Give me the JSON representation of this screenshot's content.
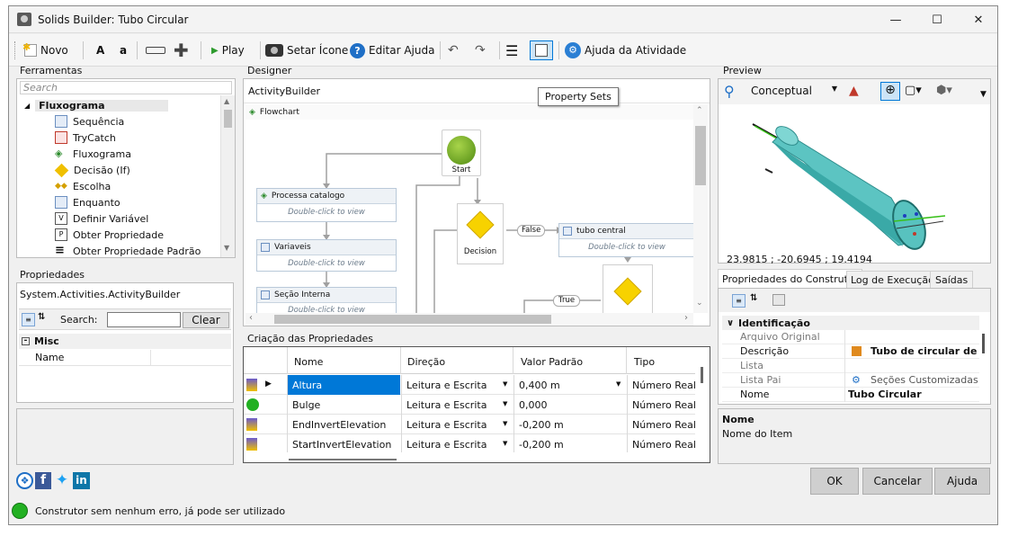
{
  "window": {
    "title": "Solids Builder: Tubo Circular"
  },
  "toolbar": {
    "novo": "Novo",
    "a_upper": "A",
    "a_lower": "a",
    "play": "Play",
    "setar_icone": "Setar Ícone",
    "editar_ajuda": "Editar Ajuda",
    "ajuda_atividade": "Ajuda da Atividade"
  },
  "tooltip": "Property Sets",
  "ferramentas": {
    "title": "Ferramentas",
    "search_placeholder": "Search",
    "group": "Fluxograma",
    "items": [
      "Sequência",
      "TryCatch",
      "Fluxograma",
      "Decisão (If)",
      "Escolha",
      "Enquanto",
      "Definir Variável",
      "Obter Propriedade",
      "Obter Propriedade Padrão"
    ]
  },
  "propriedades": {
    "title": "Propriedades",
    "object": "System.Activities.ActivityBuilder",
    "search_label": "Search:",
    "clear": "Clear",
    "category": "Misc",
    "row_name": "Name"
  },
  "designer": {
    "title": "Designer",
    "breadcrumb": "ActivityBuilder",
    "flowchart": "Flowchart",
    "start": "Start",
    "decision": "Decision",
    "false_label": "False",
    "true_label": "True",
    "dbl": "Double-click to view",
    "activities": [
      "Processa catalogo",
      "Variaveis",
      "Seção Interna",
      "tubo central"
    ]
  },
  "criacao": {
    "title": "Criação das Propriedades",
    "columns": [
      "Nome",
      "Direção",
      "Valor Padrão",
      "Tipo"
    ],
    "rows": [
      {
        "nome": "Altura",
        "direcao": "Leitura e Escrita",
        "valor": "0,400 m",
        "tipo": "Número Real"
      },
      {
        "nome": "Bulge",
        "direcao": "Leitura e Escrita",
        "valor": "0,000",
        "tipo": "Número Real"
      },
      {
        "nome": "EndInvertElevation",
        "direcao": "Leitura e Escrita",
        "valor": "-0,200 m",
        "tipo": "Número Real"
      },
      {
        "nome": "StartInvertElevation",
        "direcao": "Leitura e Escrita",
        "valor": "-0,200 m",
        "tipo": "Número Real"
      }
    ]
  },
  "preview": {
    "title": "Preview",
    "style": "Conceptual",
    "coords": "23.9815 ; -20.6945 ; 19.4194"
  },
  "tabs": [
    "Propriedades do Construtor",
    "Log de Execução",
    "Saídas"
  ],
  "construtor": {
    "category": "Identificação",
    "rows": [
      {
        "label": "Arquivo Original",
        "value": ""
      },
      {
        "label": "Descrição",
        "value": "Tubo de circular de"
      },
      {
        "label": "Lista",
        "value": ""
      },
      {
        "label": "Lista Pai",
        "value": "Seções Customizadas"
      },
      {
        "label": "Nome",
        "value": "Tubo Circular"
      }
    ],
    "help_title": "Nome",
    "help_text": "Nome do Item"
  },
  "buttons": {
    "ok": "OK",
    "cancelar": "Cancelar",
    "ajuda": "Ajuda"
  },
  "status": "Construtor sem nenhum erro, já pode ser utilizado",
  "colors": {
    "accent": "#0078d7",
    "status_ok": "#22b022",
    "cylinder": "#56c0bf",
    "selection": "#0078d7"
  }
}
